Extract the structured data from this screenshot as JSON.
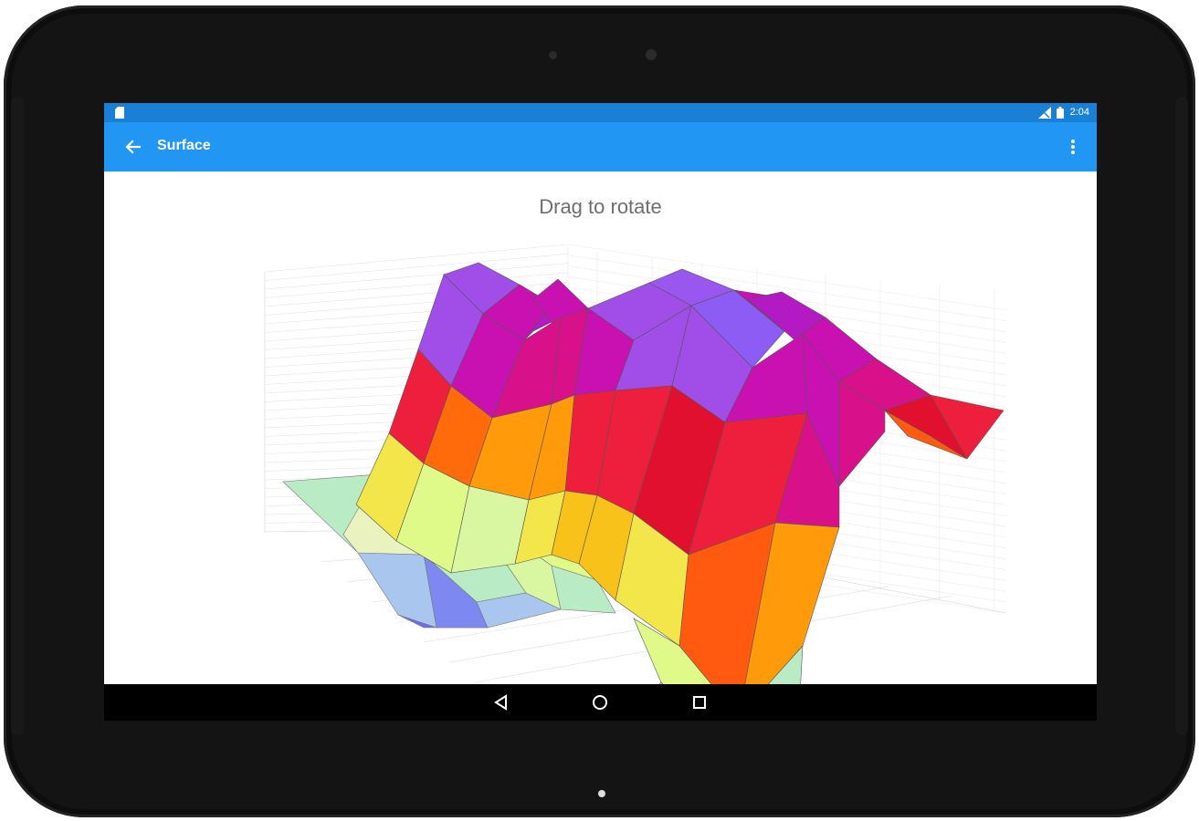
{
  "status_bar": {
    "time": "2:04",
    "icons": [
      "sd-card-icon",
      "signal-icon",
      "battery-icon"
    ]
  },
  "app_bar": {
    "title": "Surface",
    "back_icon": "arrow-back-icon",
    "menu_icon": "more-vert-icon"
  },
  "content": {
    "prompt": "Drag to rotate"
  },
  "nav_bar": {
    "buttons": [
      "back-triangle-icon",
      "home-circle-icon",
      "recents-square-icon"
    ]
  },
  "chart_data": {
    "type": "surface",
    "rotatable": true,
    "grid": true,
    "colorscale": [
      "#6a6cf0",
      "#a9c6ee",
      "#b9ecc4",
      "#e0fa8a",
      "#f3e64a",
      "#f8c21a",
      "#ff9a0a",
      "#ff5a10",
      "#ee1f3c",
      "#d8108a",
      "#c811b0",
      "#a14ee8"
    ]
  }
}
